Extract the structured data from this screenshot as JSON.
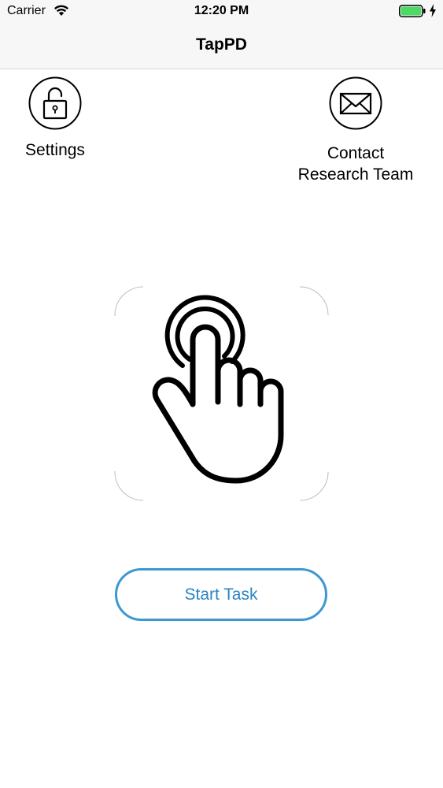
{
  "status_bar": {
    "carrier": "Carrier",
    "time": "12:20 PM",
    "battery_color": "#4cd964"
  },
  "nav": {
    "title": "TapPD"
  },
  "actions": {
    "settings": {
      "label": "Settings",
      "icon": "lock-icon"
    },
    "contact": {
      "label_line1": "Contact",
      "label_line2": "Research Team",
      "icon": "envelope-icon"
    }
  },
  "main": {
    "image_icon": "tap-hand-icon",
    "start_button_label": "Start Task",
    "accent_color": "#3d97d3"
  }
}
